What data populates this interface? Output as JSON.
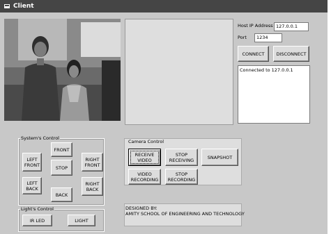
{
  "window": {
    "title": "Client"
  },
  "connection": {
    "host_label": "Host IP Address",
    "host_value": "127.0.0.1",
    "port_label": "Port",
    "port_value": "1234",
    "connect_label": "CONNECT",
    "disconnect_label": "DISCONNECT",
    "status_text": "Connected to 127.0.0.1"
  },
  "systems_control": {
    "title": "System's Control",
    "front": "FRONT",
    "left_front": "LEFT\nFRONT",
    "right_front": "RIGHT\nFRONT",
    "stop": "STOP",
    "left_back": "LEFT\nBACK",
    "right_back": "RIGHT\nBACK",
    "back": "BACK"
  },
  "lights_control": {
    "title": "Light's Control",
    "ir_led": "IR LED",
    "light": "LIGHT"
  },
  "camera_control": {
    "title": "Camera Control",
    "receive_video": "RECEIVE\nVIDEO",
    "stop_receiving": "STOP\nRECEIVING",
    "snapshot": "SNAPSHOT",
    "video_recording": "VIDEO\nRECORDING",
    "stop_recording": "STOP\nRECORDING"
  },
  "footer": {
    "designed_by": "DESIGNED BY:",
    "institution": "AMITY SCHOOL OF ENGINEERING AND TECHNOLOGY"
  },
  "colors": {
    "titlebar": "#454545",
    "window_bg": "#c8c8c8",
    "button_face": "#dcdcdc"
  }
}
